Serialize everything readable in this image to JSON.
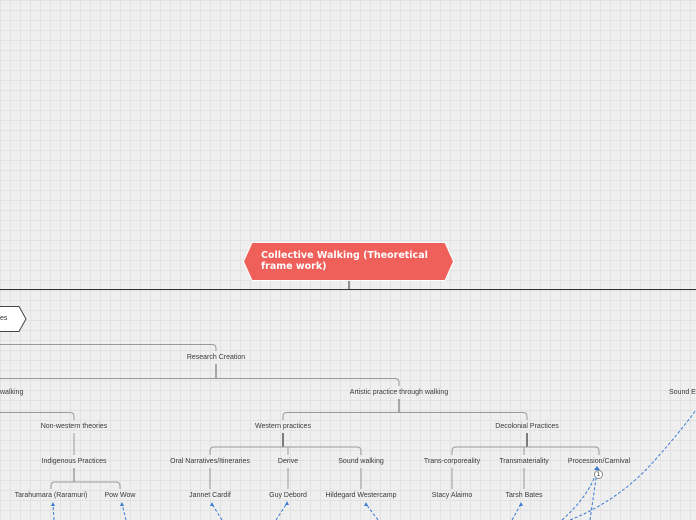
{
  "root": {
    "title": "Collective Walking (Theoretical frame work)",
    "color": "#f0605a"
  },
  "left_tab": {
    "label": "es"
  },
  "level1": {
    "research_creation": "Research Creation"
  },
  "level2": {
    "walking": "walking",
    "artistic_practice": "Artistic practice through walking",
    "sound": "Sound E"
  },
  "level3": {
    "non_western": "Non-western theories",
    "western": "Western practices",
    "decolonial": "Decolonial Practices"
  },
  "level4": {
    "indigenous": "Indigenous Practices",
    "oral": "Oral Narratives/Itineraries",
    "derive": "Derive",
    "sound_walking": "Sound walking",
    "trans_corporeality": "Trans-corporeality",
    "transmateriality": "Transmateriality",
    "procession": "Procession/Carnival"
  },
  "level5": {
    "tarahumara": "Tarahumara (Raramuri)",
    "pow_wow": "Pow Wow",
    "jannet": "Jannet Cardif",
    "guy": "Guy Debord",
    "hildegard": "Hildegard Westercamp",
    "stacy": "Stacy Alaimo",
    "tarsh": "Tarsh Bates"
  },
  "badge": {
    "count": "1"
  },
  "colors": {
    "line": "#9a9a9a",
    "dark_line": "#555555",
    "relation": "#3a7bd5"
  }
}
